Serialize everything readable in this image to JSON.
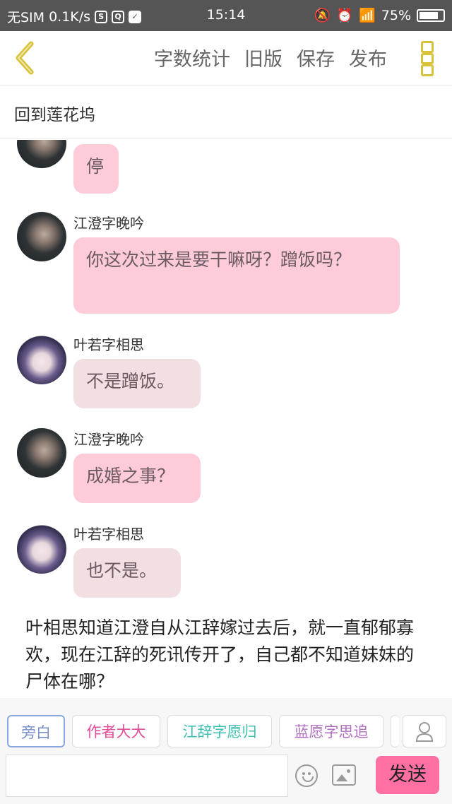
{
  "status": {
    "carrier": "无SIM",
    "speed": "0.1K/s",
    "icons": [
      "sim-icon",
      "app-icon",
      "message-icon"
    ],
    "time": "15:14",
    "battery": "75%"
  },
  "toolbar": {
    "word_count": "字数统计",
    "old_version": "旧版",
    "save": "保存",
    "publish": "发布"
  },
  "chapter_title": "回到莲花坞",
  "messages": [
    {
      "name": "",
      "text": "停"
    },
    {
      "name": "江澄字晚吟",
      "text": "你这次过来是要干嘛呀？蹭饭吗？"
    },
    {
      "name": "叶若字相思",
      "text": "不是蹭饭。"
    },
    {
      "name": "江澄字晚吟",
      "text": "成婚之事？"
    },
    {
      "name": "叶若字相思",
      "text": "也不是。"
    }
  ],
  "narration": "叶相思知道江澄自从江辞嫁过去后，就一直郁郁寡欢，现在江辞的死讯传开了，自己都不知道妹妹的尸体在哪？",
  "roles": [
    "旁白",
    "作者大大",
    "江辞字愿归",
    "蓝愿字思追"
  ],
  "role_colors": {
    "narrator": "#7a8fc8",
    "author": "#e0509a",
    "jiangci": "#3fbfb0",
    "lanyuan": "#b070c0"
  },
  "send_label": "发送",
  "colors": {
    "pink_bubble": "#fecbd8",
    "beige_bubble": "#f1dfe1",
    "accent": "#ff6fa3"
  }
}
